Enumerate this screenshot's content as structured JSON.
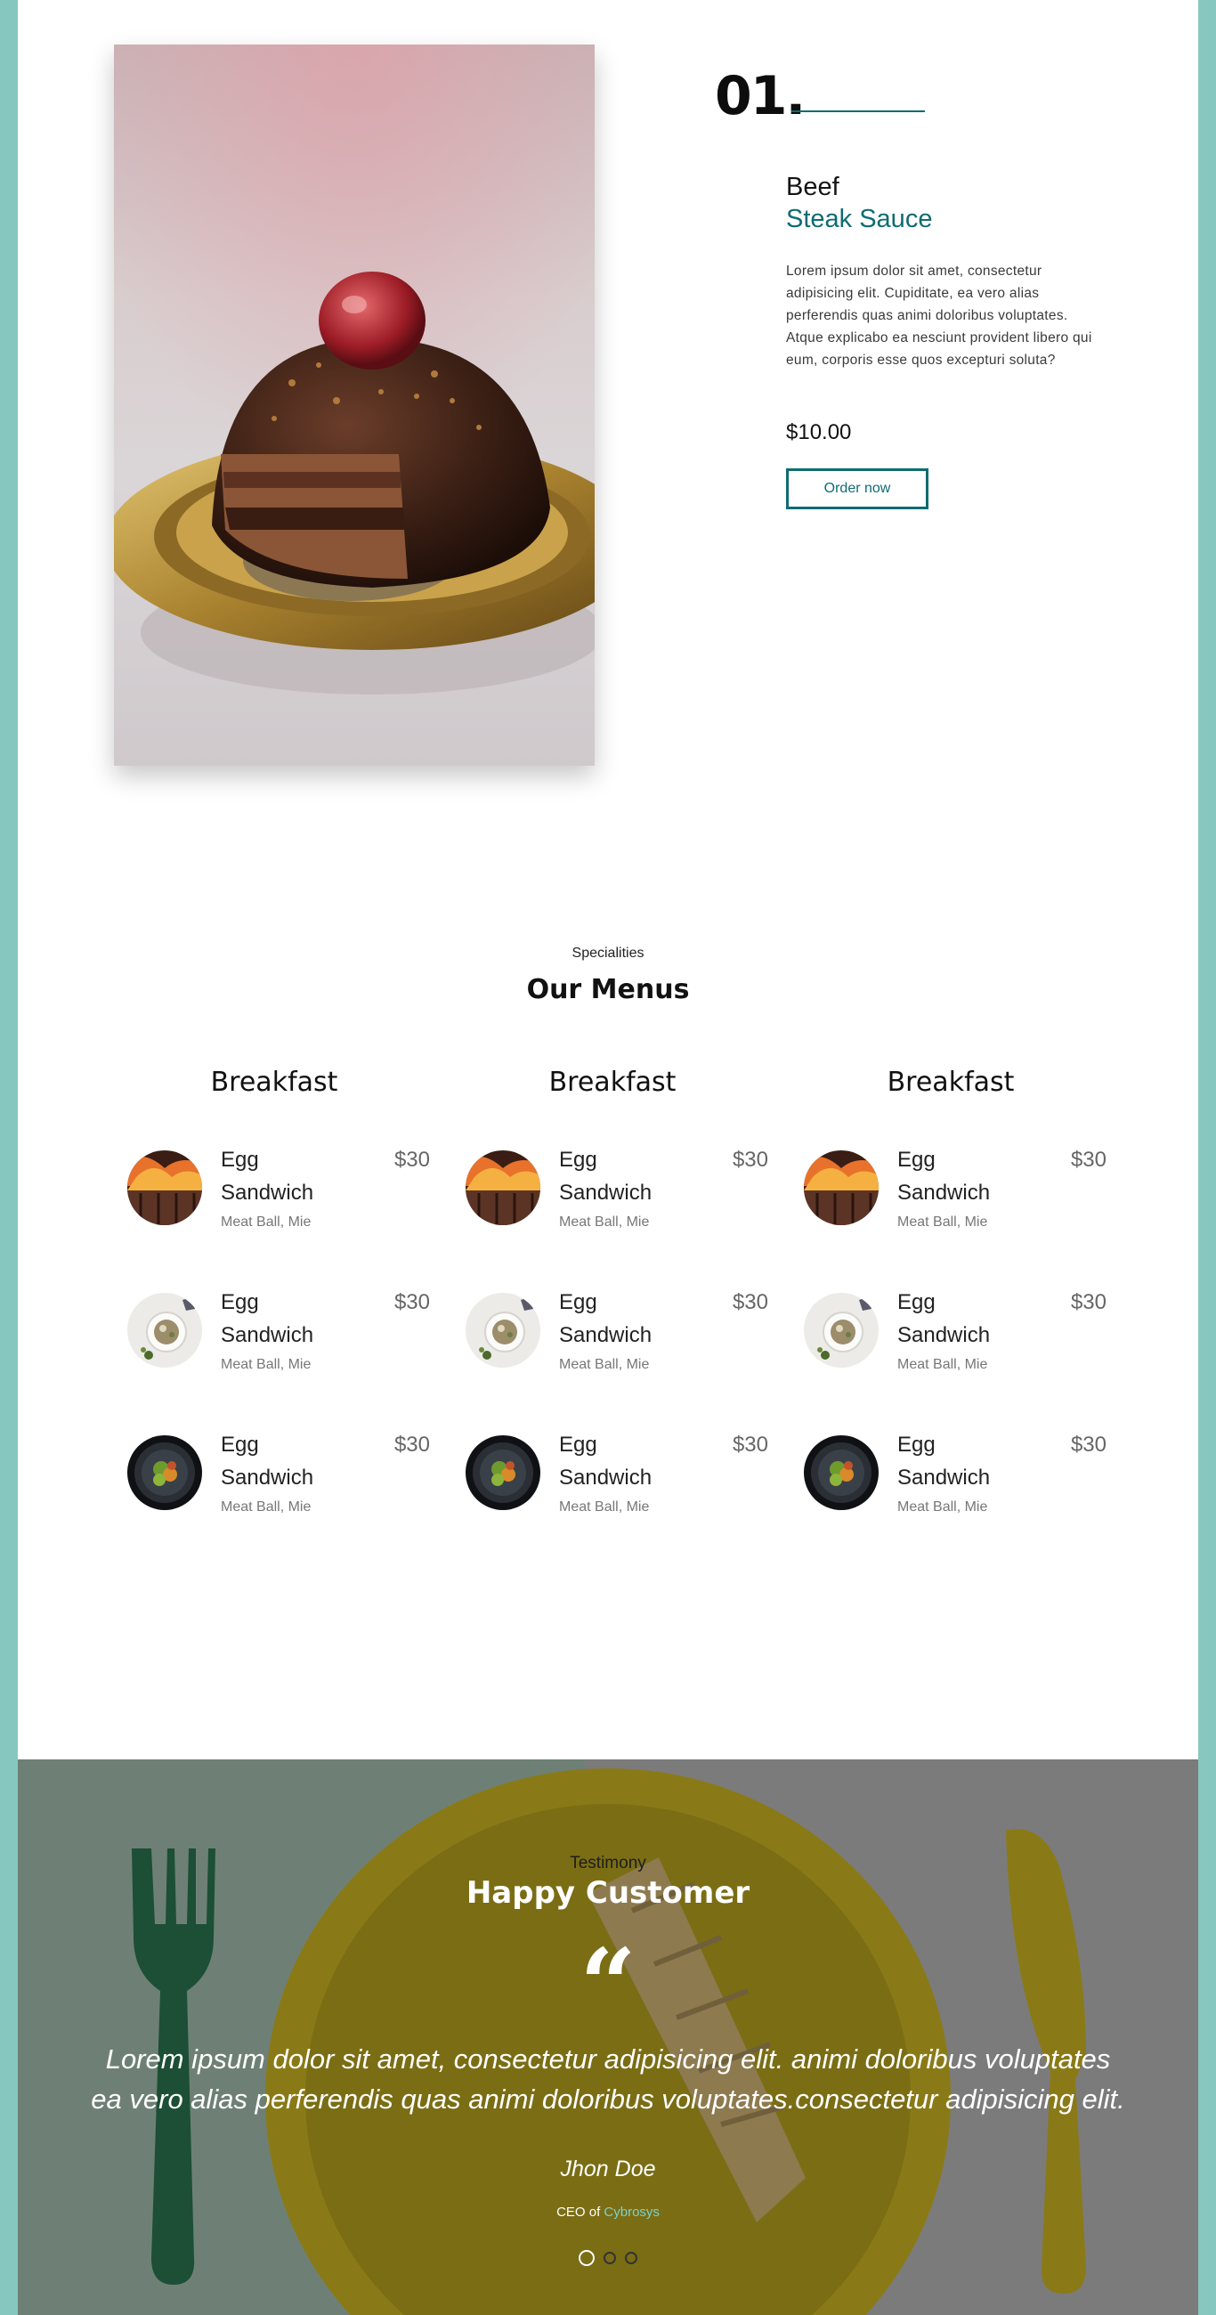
{
  "featured": {
    "number": "01.",
    "title_line1": "Beef",
    "title_line2": "Steak Sauce",
    "description": "Lorem ipsum dolor sit amet, consectetur adipisicing elit. Cupiditate, ea vero alias perferendis quas animi doloribus voluptates. Atque explicabo ea nesciunt provident libero qui eum, corporis esse quos excepturi soluta?",
    "price": "$10.00",
    "order_label": "Order now",
    "accent_color": "#0e6c71"
  },
  "menus": {
    "kicker": "Specialities",
    "title": "Our Menus",
    "columns": [
      {
        "title": "Breakfast",
        "items": [
          {
            "name": "Egg Sandwich",
            "price": "$30",
            "ingredients": "Meat Ball, Mie",
            "image": "grilled-meat"
          },
          {
            "name": "Egg Sandwich",
            "price": "$30",
            "ingredients": "Meat Ball, Mie",
            "image": "soup-bowl"
          },
          {
            "name": "Egg Sandwich",
            "price": "$30",
            "ingredients": "Meat Ball, Mie",
            "image": "dark-plate-salad"
          }
        ]
      },
      {
        "title": "Breakfast",
        "items": [
          {
            "name": "Egg Sandwich",
            "price": "$30",
            "ingredients": "Meat Ball, Mie",
            "image": "grilled-meat"
          },
          {
            "name": "Egg Sandwich",
            "price": "$30",
            "ingredients": "Meat Ball, Mie",
            "image": "soup-bowl"
          },
          {
            "name": "Egg Sandwich",
            "price": "$30",
            "ingredients": "Meat Ball, Mie",
            "image": "dark-plate-salad"
          }
        ]
      },
      {
        "title": "Breakfast",
        "items": [
          {
            "name": "Egg Sandwich",
            "price": "$30",
            "ingredients": "Meat Ball, Mie",
            "image": "grilled-meat"
          },
          {
            "name": "Egg Sandwich",
            "price": "$30",
            "ingredients": "Meat Ball, Mie",
            "image": "soup-bowl"
          },
          {
            "name": "Egg Sandwich",
            "price": "$30",
            "ingredients": "Meat Ball, Mie",
            "image": "dark-plate-salad"
          }
        ]
      }
    ]
  },
  "testimony": {
    "kicker": "Testimony",
    "title": "Happy Customer",
    "quote_icon": "quote-icon",
    "quote": "Lorem ipsum dolor sit amet, consectetur adipisicing elit. animi doloribus voluptates ea vero alias perferendis quas animi doloribus voluptates.consectetur adipisicing elit.",
    "author": "Jhon Doe",
    "role_prefix": "CEO of",
    "company": "Cybrosys",
    "slide_count": 3,
    "active_slide": 1
  }
}
